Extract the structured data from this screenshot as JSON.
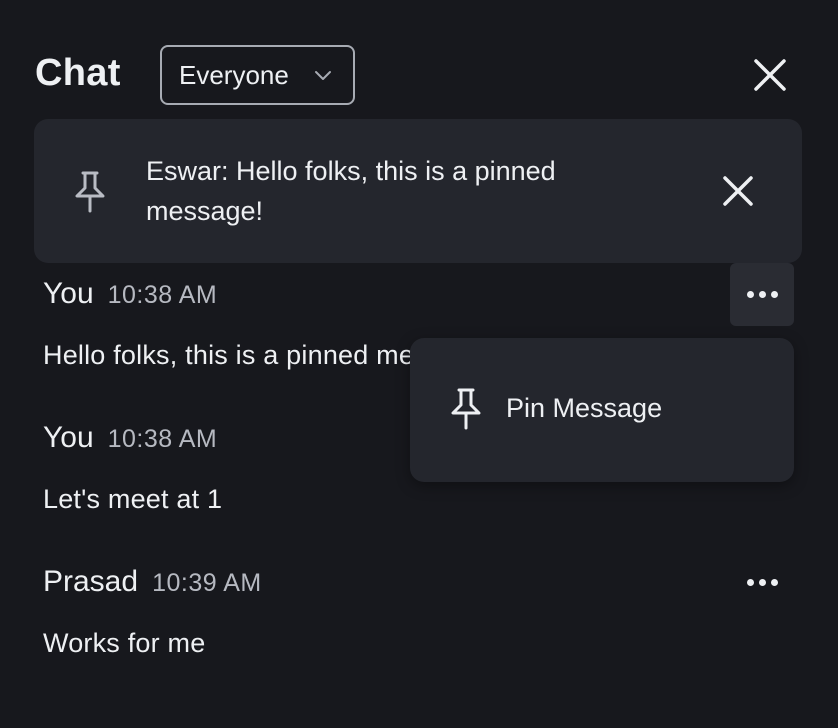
{
  "header": {
    "title": "Chat",
    "audience_select": {
      "value": "Everyone",
      "icon": "chevron-down-icon"
    },
    "close_icon": "close-icon"
  },
  "pinned": {
    "icon": "pin-icon",
    "text": "Eswar: Hello folks, this is a pinned message!",
    "close_icon": "close-icon"
  },
  "messages": [
    {
      "sender": "You",
      "time": "10:38 AM",
      "text": "Hello folks, this is a pinned message!",
      "has_more_menu": true,
      "menu_open": true
    },
    {
      "sender": "You",
      "time": "10:38 AM",
      "text": "Let's meet at 1",
      "has_more_menu": false
    },
    {
      "sender": "Prasad",
      "time": "10:39 AM",
      "text": "Works for me",
      "has_more_menu": true,
      "menu_open": false
    }
  ],
  "context_menu": {
    "items": [
      {
        "label": "Pin Message",
        "icon": "pin-icon"
      }
    ]
  },
  "colors": {
    "background": "#17181d",
    "surface": "#24262d",
    "text": "#eef0f3",
    "muted_text": "#b6b9c1",
    "border": "#a7abb3"
  }
}
